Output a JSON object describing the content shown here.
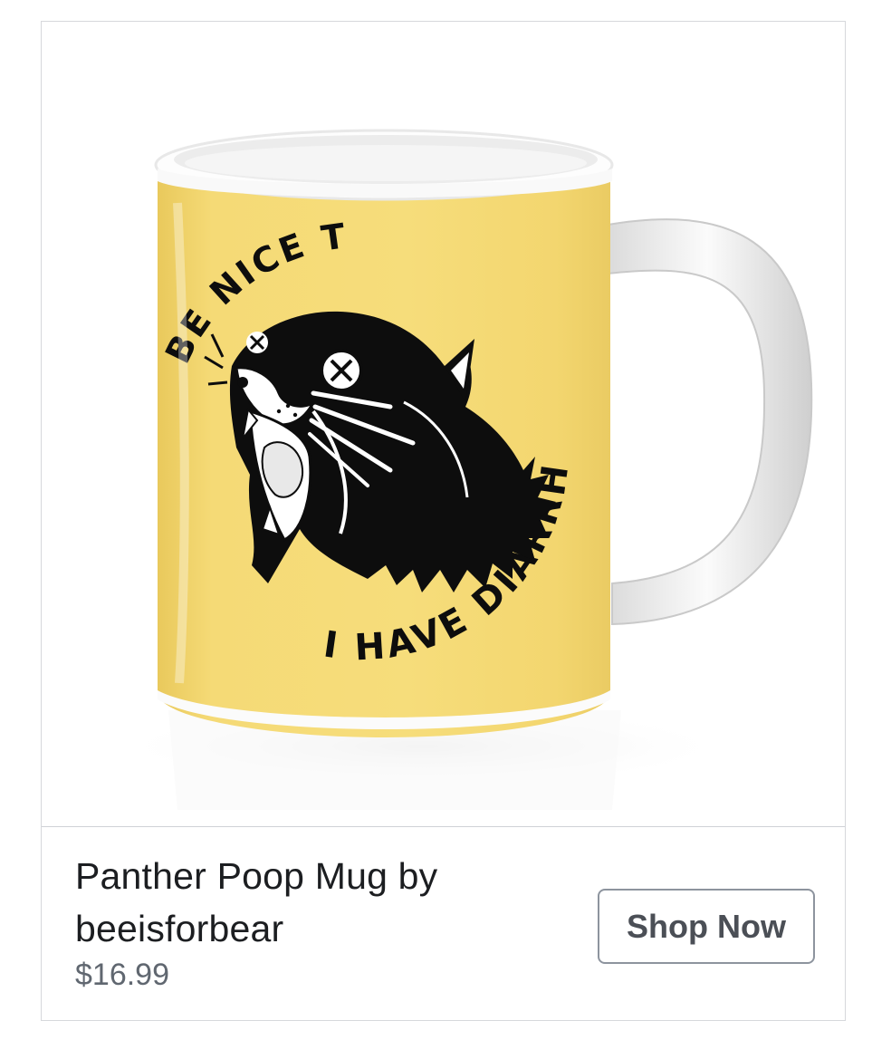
{
  "product": {
    "title": "Panther Poop Mug by beeisforbear",
    "price": "$16.99",
    "image_alt": "Yellow mug with black panther illustration"
  },
  "mug_art": {
    "top_text": "BE NICE TO ME",
    "bottom_text": "I HAVE DIARRHEA"
  },
  "cta": {
    "label": "Shop Now"
  },
  "colors": {
    "mug_yellow": "#f3d872",
    "ink": "#0d0d0d",
    "button_border": "#8d949e",
    "price_gray": "#606770"
  }
}
